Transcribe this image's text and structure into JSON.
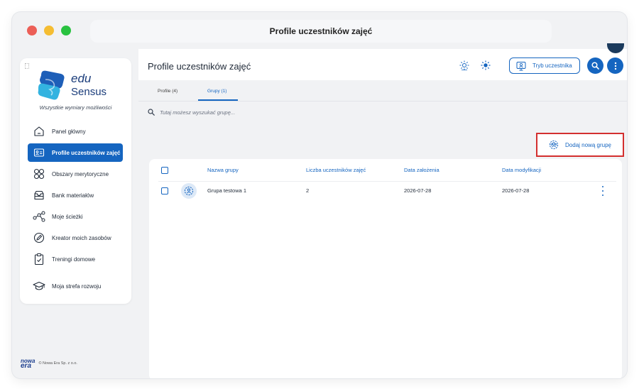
{
  "window": {
    "title": "Profile uczestników zajęć",
    "traffic_lights": {
      "close": "#ec5f57",
      "minimize": "#f5bd32",
      "maximize": "#29c240"
    }
  },
  "brand": {
    "logo_line1": "edu",
    "logo_line2": "Sensus",
    "tagline": "Wszystkie wymiary możliwości",
    "accent": "#1565c0"
  },
  "sidebar": {
    "items": [
      {
        "label": "Panel główny",
        "icon": "home-icon",
        "active": false
      },
      {
        "label": "Profile uczestników zajęć",
        "icon": "id-card-icon",
        "active": true
      },
      {
        "label": "Obszary merytoryczne",
        "icon": "grid-icon",
        "active": false
      },
      {
        "label": "Bank materiałów",
        "icon": "inbox-icon",
        "active": false
      },
      {
        "label": "Moje ścieżki",
        "icon": "share-nodes-icon",
        "active": false
      },
      {
        "label": "Kreator moich zasobów",
        "icon": "edit-circle-icon",
        "active": false
      },
      {
        "label": "Treningi domowe",
        "icon": "clipboard-check-icon",
        "active": false
      },
      {
        "label": "Moja strefa rozwoju",
        "icon": "graduation-cap-icon",
        "active": false
      }
    ]
  },
  "footer": {
    "logo_line1": "nowa",
    "logo_line2": "era",
    "copyright": "© Nowa Era Sp. z o.o."
  },
  "header": {
    "title": "Profile uczestników zajęć",
    "participant_button": "Tryb uczestnika"
  },
  "tabs": [
    {
      "label": "Profile (4)",
      "active": false
    },
    {
      "label": "Grupy (1)",
      "active": true
    }
  ],
  "search": {
    "placeholder": "Tutaj możesz wyszukać grupę..."
  },
  "add_group_button": "Dodaj nową grupę",
  "table": {
    "headers": {
      "name": "Nazwa grupy",
      "count": "Liczba uczestników zajęć",
      "created": "Data założenia",
      "modified": "Data modyfikacji"
    },
    "rows": [
      {
        "name": "Grupa testowa 1",
        "count": "2",
        "created": "2026-07-28",
        "modified": "2026-07-28"
      }
    ]
  }
}
